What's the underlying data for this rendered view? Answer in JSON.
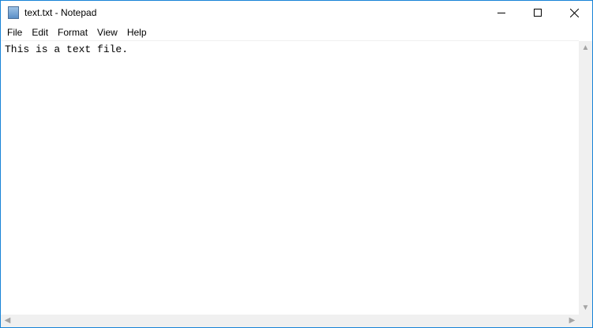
{
  "window": {
    "title": "text.txt - Notepad"
  },
  "menu": [
    "File",
    "Edit",
    "Format",
    "View",
    "Help"
  ],
  "editor": {
    "content": "This is a text file."
  },
  "icons": {
    "app": "notepad-icon",
    "minimize": "minimize-icon",
    "maximize": "maximize-icon",
    "close": "close-icon"
  },
  "colors": {
    "border": "#1883d7"
  }
}
